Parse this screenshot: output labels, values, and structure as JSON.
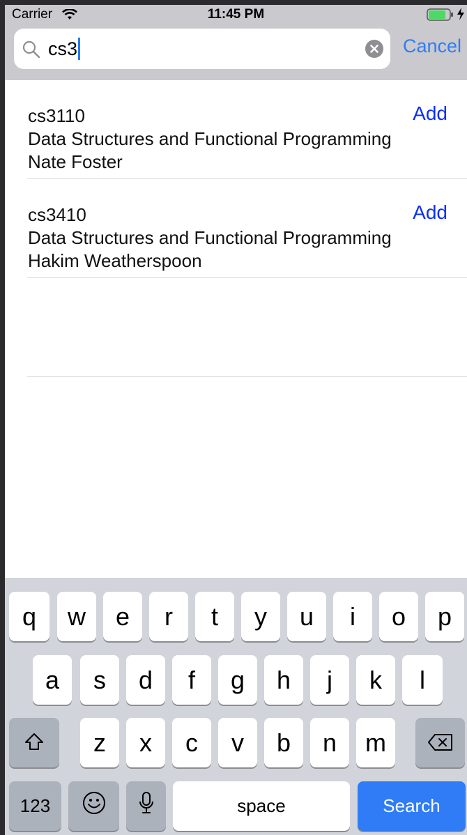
{
  "status_bar": {
    "carrier": "Carrier",
    "time": "11:45 PM"
  },
  "search": {
    "value": "cs3",
    "cancel_label": "Cancel"
  },
  "results": [
    {
      "code": "cs3110",
      "title": "Data Structures and Functional Programming",
      "instructor": "Nate Foster",
      "action": "Add"
    },
    {
      "code": "cs3410",
      "title": "Data Structures and Functional Programming",
      "instructor": "Hakim Weatherspoon",
      "action": "Add"
    }
  ],
  "keyboard": {
    "row1": [
      "q",
      "w",
      "e",
      "r",
      "t",
      "y",
      "u",
      "i",
      "o",
      "p"
    ],
    "row2": [
      "a",
      "s",
      "d",
      "f",
      "g",
      "h",
      "j",
      "k",
      "l"
    ],
    "row3": [
      "z",
      "x",
      "c",
      "v",
      "b",
      "n",
      "m"
    ],
    "numbers_label": "123",
    "space_label": "space",
    "search_label": "Search"
  },
  "colors": {
    "accent": "#2f7cf6",
    "add_link": "#0a2ff5",
    "header_bg": "#c9c9ce",
    "keyboard_bg": "#d1d4da"
  }
}
